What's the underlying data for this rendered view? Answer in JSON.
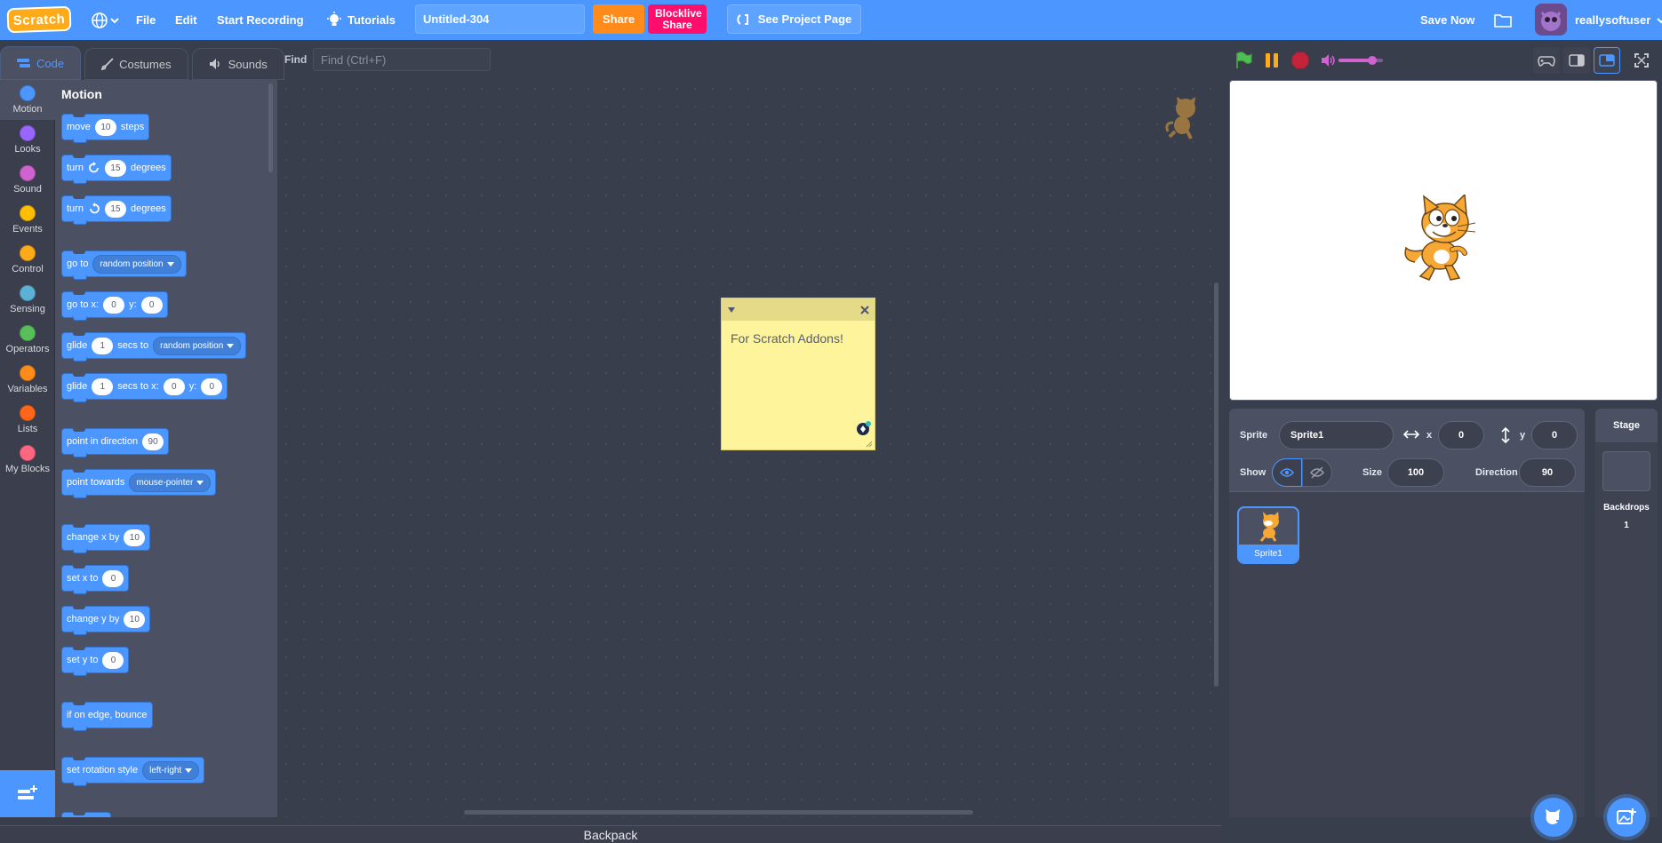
{
  "menubar": {
    "logo": "Scratch",
    "file": "File",
    "edit": "Edit",
    "start_recording": "Start Recording",
    "tutorials": "Tutorials",
    "project_title": "Untitled-304",
    "share": "Share",
    "blocklive_share": "Blocklive Share",
    "see_project_page": "See Project Page",
    "save_now": "Save Now",
    "username": "reallysoftuser"
  },
  "tabs": [
    {
      "label": "Code",
      "icon": "code-icon"
    },
    {
      "label": "Costumes",
      "icon": "brush-icon"
    },
    {
      "label": "Sounds",
      "icon": "speaker-icon"
    }
  ],
  "find": {
    "label": "Find",
    "placeholder": "Find (Ctrl+F)"
  },
  "categories": [
    {
      "label": "Motion",
      "color": "#4c97ff"
    },
    {
      "label": "Looks",
      "color": "#9966ff"
    },
    {
      "label": "Sound",
      "color": "#cf63cf"
    },
    {
      "label": "Events",
      "color": "#ffbf00"
    },
    {
      "label": "Control",
      "color": "#ffab19"
    },
    {
      "label": "Sensing",
      "color": "#5cb1d6"
    },
    {
      "label": "Operators",
      "color": "#59c059"
    },
    {
      "label": "Variables",
      "color": "#ff8c1a"
    },
    {
      "label": "Lists",
      "color": "#ff661a"
    },
    {
      "label": "My Blocks",
      "color": "#ff6680"
    }
  ],
  "palette": {
    "heading": "Motion",
    "blocks": {
      "move": {
        "a": "move",
        "n": "10",
        "b": "steps"
      },
      "turn_cw": {
        "a": "turn",
        "n": "15",
        "b": "degrees"
      },
      "turn_ccw": {
        "a": "turn",
        "n": "15",
        "b": "degrees"
      },
      "goto": {
        "a": "go to",
        "d": "random position"
      },
      "gotoxy": {
        "a": "go to x:",
        "x": "0",
        "b": "y:",
        "y": "0"
      },
      "glide_to": {
        "a": "glide",
        "n": "1",
        "b": "secs to",
        "d": "random position"
      },
      "glide_xy": {
        "a": "glide",
        "n": "1",
        "b": "secs to x:",
        "x": "0",
        "c": "y:",
        "y": "0"
      },
      "point_dir": {
        "a": "point in direction",
        "n": "90"
      },
      "point_towards": {
        "a": "point towards",
        "d": "mouse-pointer"
      },
      "change_x": {
        "a": "change x by",
        "n": "10"
      },
      "set_x": {
        "a": "set x to",
        "n": "0"
      },
      "change_y": {
        "a": "change y by",
        "n": "10"
      },
      "set_y": {
        "a": "set y to",
        "n": "0"
      },
      "bounce": {
        "a": "if on edge, bounce"
      },
      "rotation": {
        "a": "set rotation style",
        "d": "left-right"
      }
    }
  },
  "note": {
    "text": "For Scratch Addons!"
  },
  "backpack": "Backpack",
  "sprite_info": {
    "sprite_label": "Sprite",
    "sprite_name": "Sprite1",
    "x_label": "x",
    "x_value": "0",
    "y_label": "y",
    "y_value": "0",
    "show_label": "Show",
    "size_label": "Size",
    "size_value": "100",
    "direction_label": "Direction",
    "direction_value": "90",
    "sprite_tile_name": "Sprite1"
  },
  "stage_pane": {
    "title": "Stage",
    "backdrops_label": "Backdrops",
    "backdrops_count": "1"
  },
  "colors": {
    "accent": "#4c97ff",
    "share": "#ff8c1a",
    "blocklive": "#ff0e6d",
    "volume": "#cf63cf"
  },
  "volume_level": 0.75
}
